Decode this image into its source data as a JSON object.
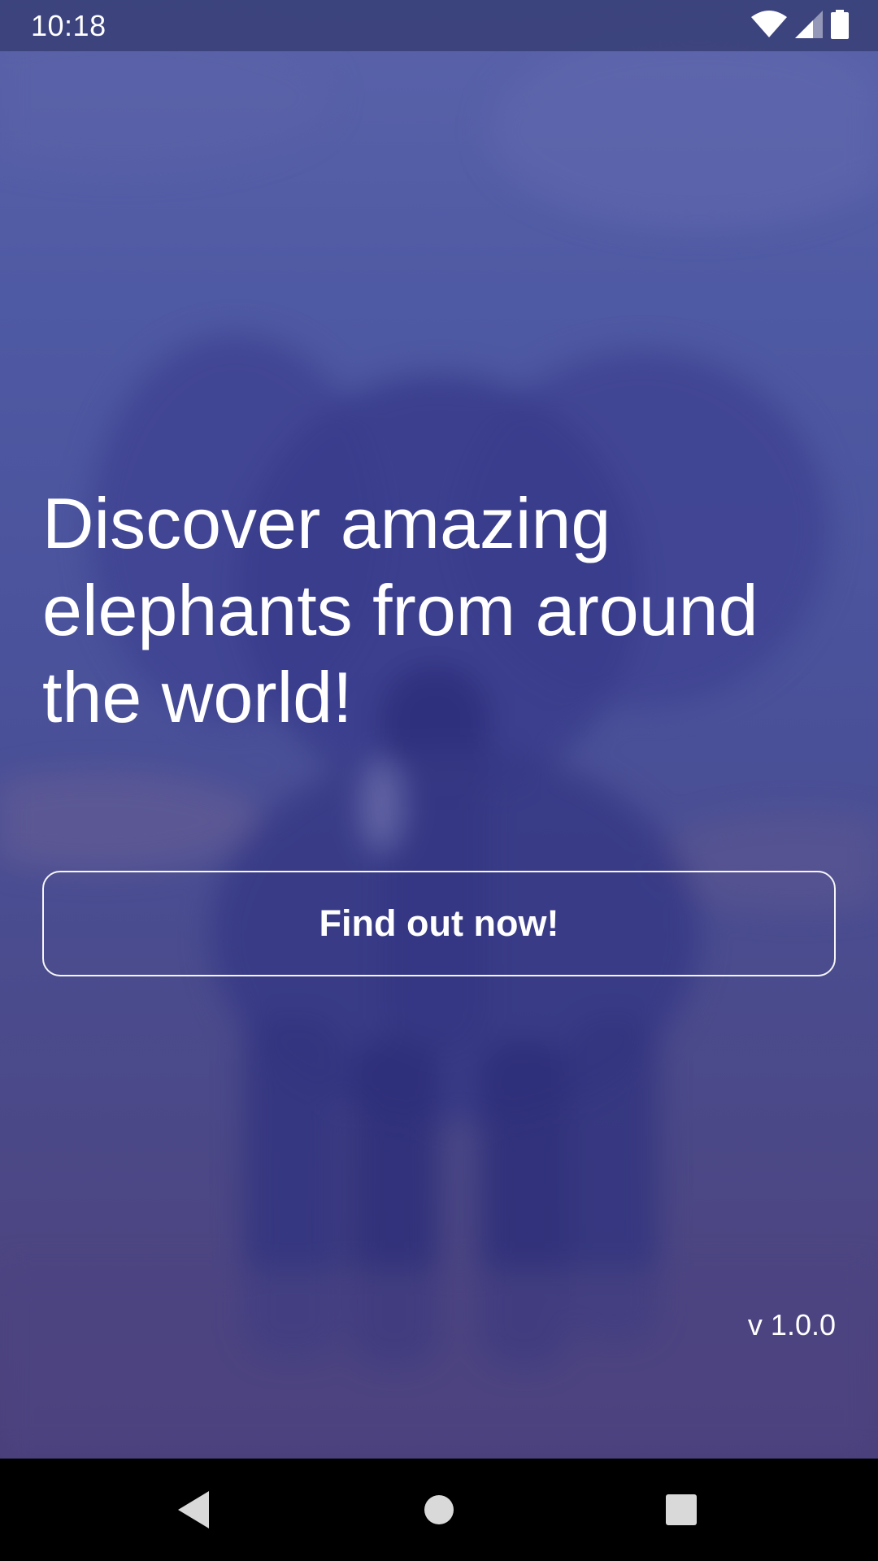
{
  "status_bar": {
    "time": "10:18",
    "icons": [
      "wifi-icon",
      "signal-icon",
      "battery-icon"
    ]
  },
  "main": {
    "headline": "Discover amazing elephants from around the world!",
    "cta_label": "Find out now!",
    "version": "v 1.0.0"
  },
  "nav_bar": {
    "icons": [
      "back-icon",
      "home-icon",
      "recents-icon"
    ]
  },
  "colors": {
    "background_top": "#5a63a9",
    "background_bottom": "#4a3f7a",
    "text": "#ffffff",
    "nav_bar": "#000000"
  }
}
